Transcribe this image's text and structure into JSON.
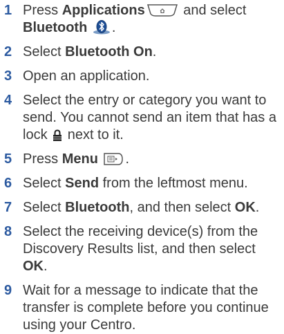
{
  "steps": [
    {
      "num": "1",
      "parts": {
        "t1": "Press ",
        "b1": "Applications",
        "t2": " and select",
        "b2": "Bluetooth",
        "t3": "."
      },
      "icons": [
        "applications-key-icon",
        "bluetooth-icon"
      ]
    },
    {
      "num": "2",
      "parts": {
        "t1": "Select ",
        "b1": "Bluetooth On",
        "t2": "."
      }
    },
    {
      "num": "3",
      "parts": {
        "t1": "Open an application."
      }
    },
    {
      "num": "4",
      "parts": {
        "t1": "Select the entry or category you want to send. You cannot send an item that has a lock",
        "t2": " next to it."
      },
      "icons": [
        "lock-icon"
      ]
    },
    {
      "num": "5",
      "parts": {
        "t1": "Press ",
        "b1": "Menu",
        "t2": "."
      },
      "icons": [
        "menu-key-icon"
      ]
    },
    {
      "num": "6",
      "parts": {
        "t1": "Select ",
        "b1": "Send",
        "t2": " from the leftmost menu."
      }
    },
    {
      "num": "7",
      "parts": {
        "t1": "Select ",
        "b1": "Bluetooth",
        "t2": ", and then select ",
        "b2": "OK",
        "t3": "."
      }
    },
    {
      "num": "8",
      "parts": {
        "t1": "Select the receiving device(s) from the Discovery Results list, and then select",
        "b1": "OK",
        "t2": "."
      }
    },
    {
      "num": "9",
      "parts": {
        "t1": "Wait for a message to indicate that the transfer is complete before you continue using your Centro."
      }
    }
  ],
  "colors": {
    "step_number": "#2c5aa0",
    "text": "#3a3a3a"
  }
}
